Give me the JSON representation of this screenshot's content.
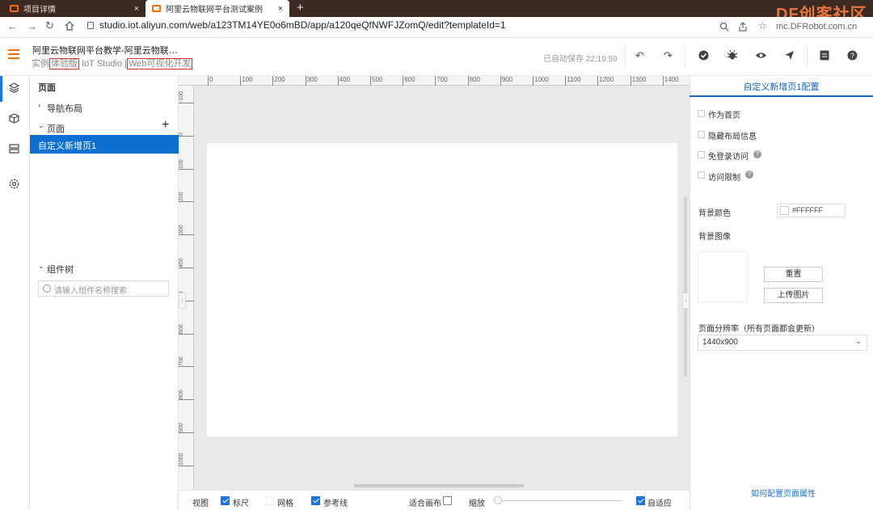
{
  "browser": {
    "tabs": [
      {
        "title": "项目详情",
        "close": "×"
      },
      {
        "title": "阿里云物联网平台测试案例",
        "close": "×"
      }
    ],
    "new_tab": "+",
    "url": "studio.iot.aliyun.com/web/a123TM14YE0o6mBD/app/a120qeQfNWFJZomQ/edit?templateId=1",
    "nav": {
      "back": "←",
      "forward": "→",
      "reload": "↻"
    },
    "watermark": "DF创客社区",
    "watermark_sub": "mc.DFRobot.com.cn"
  },
  "header": {
    "project_title": "阿里云物联网平台教学-阿里云物联…",
    "breadcrumb": {
      "instance": "实例",
      "edition": "体验版",
      "product": "IoT Studio",
      "separator": "|",
      "module": "Web可视化开发"
    },
    "autosave": "已自动保存 22:19:59",
    "icons": [
      "undo-icon",
      "redo-icon",
      "check-icon",
      "bug-icon",
      "preview-icon",
      "publish-icon",
      "doc-icon",
      "help-icon"
    ]
  },
  "sidebar": {
    "section_title": "页面",
    "nav_layout": "导航布局",
    "pages": "页面",
    "add": "+",
    "selected_page": "自定义新增页1",
    "component_tree": "组件树",
    "search_placeholder": "请输入组件名称搜索"
  },
  "ruler": {
    "top": [
      "0",
      "100",
      "200",
      "300",
      "400",
      "500",
      "600",
      "700",
      "800",
      "900",
      "1000",
      "1100",
      "1200",
      "1300",
      "1400"
    ],
    "left": [
      "-100",
      "0",
      "100",
      "200",
      "300",
      "400",
      "500",
      "600",
      "700",
      "800",
      "900",
      "1000"
    ]
  },
  "bottom": {
    "view": "视图",
    "ruler": "标尺",
    "grid": "网格",
    "guides": "参考线",
    "fit_canvas": "适合画布",
    "zoom": "缩放",
    "auto_fit": "自适应"
  },
  "right_panel": {
    "title": "自定义新增页1配置",
    "as_home": "作为首页",
    "hide_layout": "隐藏布局信息",
    "no_login": "免登录访问",
    "access_limit": "访问限制",
    "bg_color_label": "背景颜色",
    "bg_color_value": "#FFFFFF",
    "bg_image_label": "背景图像",
    "reset": "重置",
    "upload": "上传图片",
    "resolution_label": "页面分辨率（所有页面都会更新）",
    "resolution_value": "1440x900",
    "help_link": "如何配置页面属性"
  }
}
